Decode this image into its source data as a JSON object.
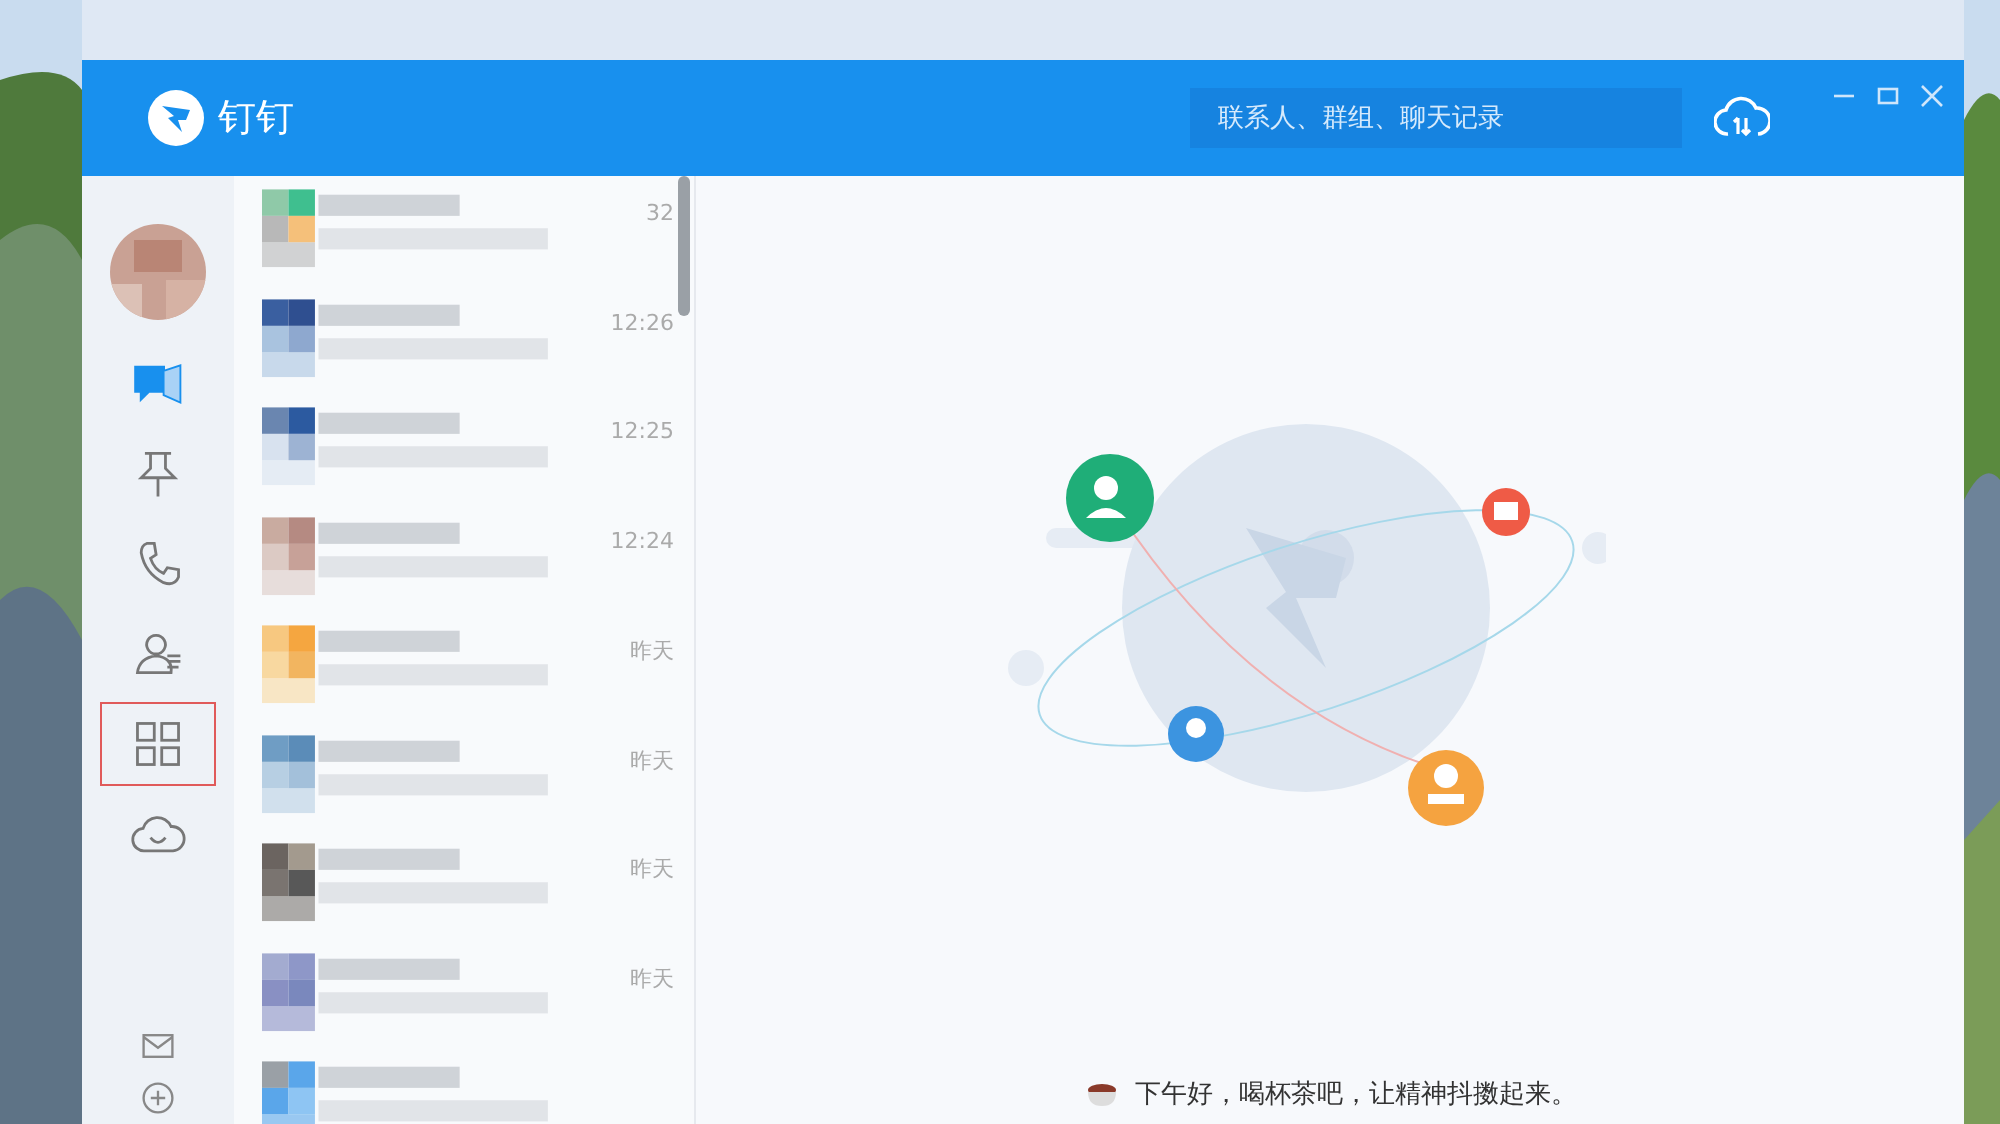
{
  "app": {
    "name": "钉钉"
  },
  "search": {
    "placeholder": "联系人、群组、聊天记录"
  },
  "nav": [
    {
      "kind": "chat",
      "selected": true,
      "highlighted": false
    },
    {
      "kind": "pin",
      "selected": false,
      "highlighted": false
    },
    {
      "kind": "phone",
      "selected": false,
      "highlighted": false
    },
    {
      "kind": "contacts",
      "selected": false,
      "highlighted": false
    },
    {
      "kind": "apps",
      "selected": false,
      "highlighted": true
    },
    {
      "kind": "cloud",
      "selected": false,
      "highlighted": false
    }
  ],
  "nav_bottom": [
    {
      "kind": "mail"
    },
    {
      "kind": "add"
    }
  ],
  "chats": [
    {
      "kind": "chat",
      "time": "32"
    },
    {
      "kind": "chat",
      "time": "12:26"
    },
    {
      "kind": "chat",
      "time": "12:25"
    },
    {
      "kind": "chat",
      "time": "12:24"
    },
    {
      "kind": "chat",
      "time": "昨天"
    },
    {
      "kind": "chat",
      "time": "昨天"
    },
    {
      "kind": "chat",
      "time": "昨天"
    },
    {
      "kind": "chat",
      "time": "昨天"
    },
    {
      "kind": "chat"
    }
  ],
  "greeting": "下午好，喝杯茶吧，让精神抖擞起来。"
}
